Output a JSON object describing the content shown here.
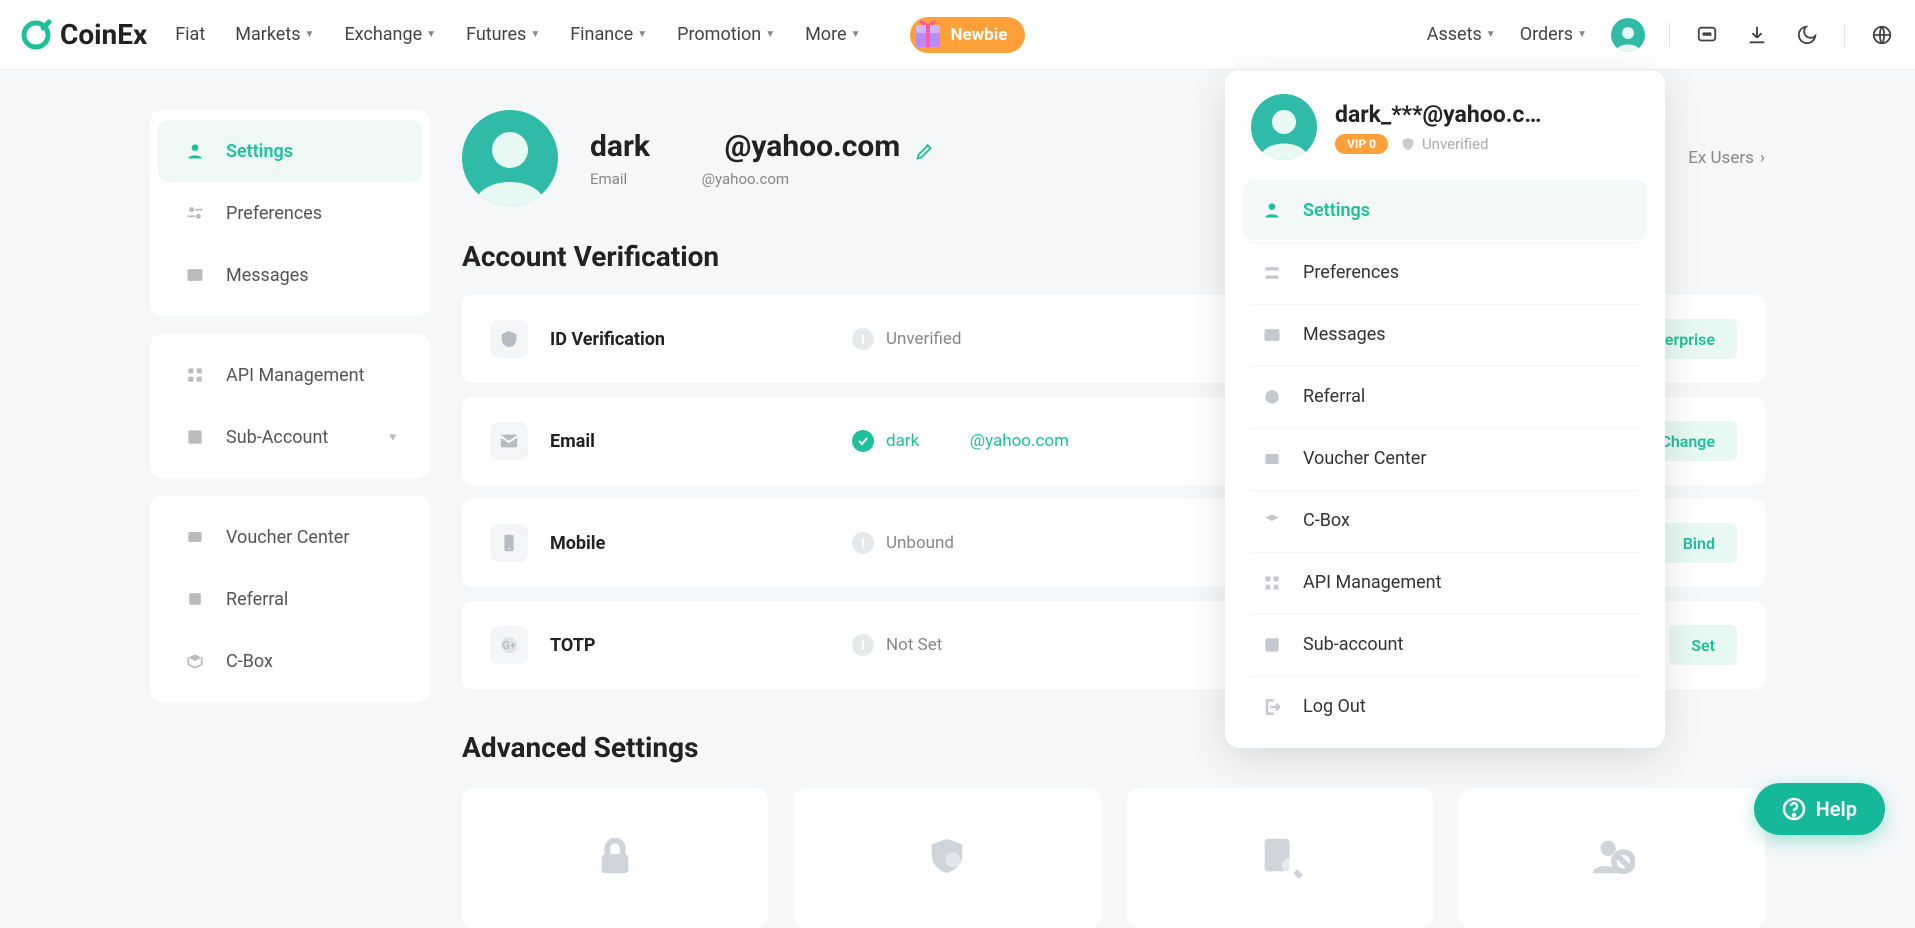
{
  "brand": "CoinEx",
  "nav": {
    "fiat": "Fiat",
    "markets": "Markets",
    "exchange": "Exchange",
    "futures": "Futures",
    "finance": "Finance",
    "promotion": "Promotion",
    "more": "More",
    "newbie": "Newbie",
    "assets": "Assets",
    "orders": "Orders"
  },
  "sidebar": {
    "g1": [
      {
        "label": "Settings"
      },
      {
        "label": "Preferences"
      },
      {
        "label": "Messages"
      }
    ],
    "g2": [
      {
        "label": "API Management"
      },
      {
        "label": "Sub-Account"
      }
    ],
    "g3": [
      {
        "label": "Voucher Center"
      },
      {
        "label": "Referral"
      },
      {
        "label": "C-Box"
      }
    ]
  },
  "profile": {
    "name": "dark          @yahoo.com",
    "email_label": "Email",
    "email_value": "@yahoo.com"
  },
  "ex_users": "Ex Users",
  "section": {
    "verification": "Account Verification",
    "advanced": "Advanced Settings"
  },
  "rows": {
    "id": {
      "label": "ID Verification",
      "status": "Unverified",
      "action": "Enterprise"
    },
    "email": {
      "label": "Email",
      "status": "dark            @yahoo.com",
      "action": "Change"
    },
    "mobile": {
      "label": "Mobile",
      "status": "Unbound",
      "action": "Bind"
    },
    "totp": {
      "label": "TOTP",
      "status": "Not Set",
      "action": "Set"
    }
  },
  "dropdown": {
    "name": "dark_***@yahoo.c…",
    "vip": "VIP 0",
    "unverified": "Unverified",
    "items": [
      {
        "label": "Settings"
      },
      {
        "label": "Preferences"
      },
      {
        "label": "Messages"
      },
      {
        "label": "Referral"
      },
      {
        "label": "Voucher Center"
      },
      {
        "label": "C-Box"
      },
      {
        "label": "API Management"
      },
      {
        "label": "Sub-account"
      },
      {
        "label": "Log Out"
      }
    ]
  },
  "help": "Help"
}
